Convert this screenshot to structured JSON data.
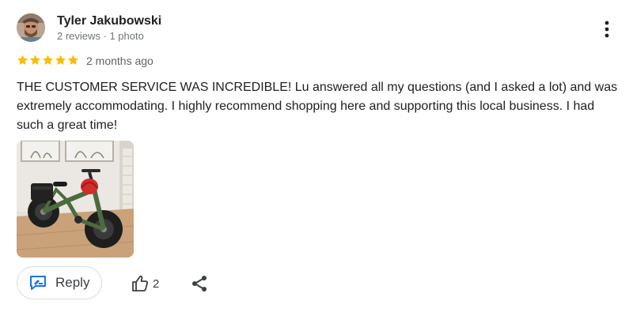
{
  "reviewer": {
    "name": "Tyler Jakubowski",
    "meta": "2 reviews · 1 photo"
  },
  "rating": {
    "stars": 5,
    "max": 5,
    "date": "2 months ago"
  },
  "review": {
    "text": "THE CUSTOMER SERVICE WAS INCREDIBLE! Lu answered all my questions (and I asked a lot) and was extremely accommodating. I highly recommend shopping here and supporting this local business. I had such a great time!"
  },
  "actions": {
    "reply_label": "Reply",
    "like_count": "2"
  },
  "icons": {
    "more": "more-vert-icon",
    "star": "star-icon",
    "reply": "reply-icon",
    "like": "thumbs-up-icon",
    "share": "share-icon"
  },
  "colors": {
    "star": "#fbbc04",
    "reply_icon": "#1a73e8",
    "meta_text": "#70757a",
    "border": "#dadce0"
  }
}
